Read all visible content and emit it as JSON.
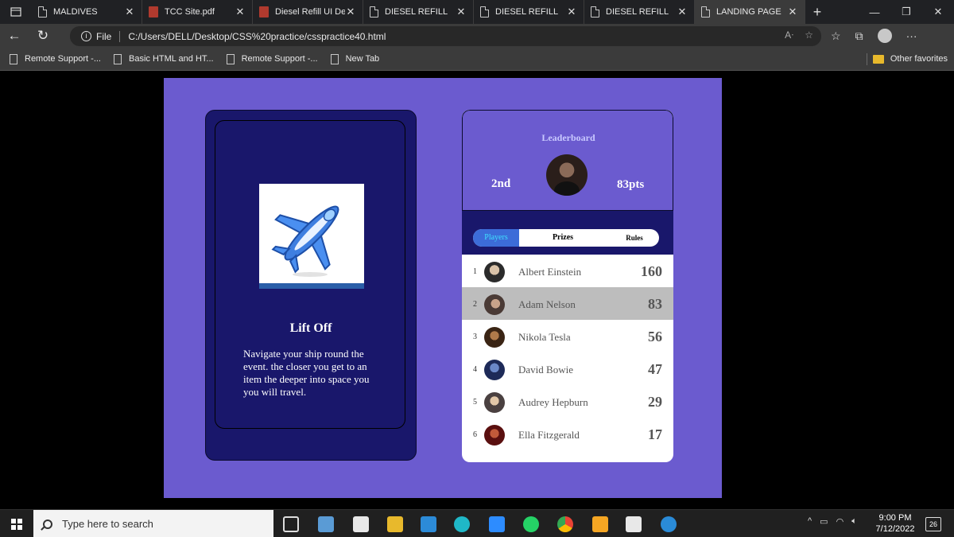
{
  "browser": {
    "tabs": [
      {
        "label": "MALDIVES",
        "icon": "document-icon"
      },
      {
        "label": "TCC Site.pdf",
        "icon": "pdf-icon"
      },
      {
        "label": "Diesel Refill UI De",
        "icon": "pdf-icon"
      },
      {
        "label": "DIESEL REFILL",
        "icon": "document-icon"
      },
      {
        "label": "DIESEL REFILL",
        "icon": "document-icon"
      },
      {
        "label": "DIESEL REFILL",
        "icon": "document-icon"
      },
      {
        "label": "LANDING PAGE",
        "icon": "document-icon",
        "active": true
      }
    ],
    "address": {
      "scheme_label": "File",
      "url": "C:/Users/DELL/Desktop/CSS%20practice/csspractice40.html"
    },
    "favorites": [
      {
        "label": "Remote Support -..."
      },
      {
        "label": "Basic HTML and HT..."
      },
      {
        "label": "Remote Support -..."
      },
      {
        "label": "New Tab"
      }
    ],
    "other_favorites": "Other favorites"
  },
  "card": {
    "title": "Lift Off",
    "description": "Navigate your ship round the event. the closer you get to an item the deeper into space you you will travel."
  },
  "leaderboard": {
    "title": "Leaderboard",
    "rank": "2nd",
    "points": "83pts",
    "tabs": {
      "players": "Players",
      "prizes": "Prizes",
      "rules": "Rules"
    },
    "players": [
      {
        "rank": "1",
        "name": "Albert Einstein",
        "score": "160"
      },
      {
        "rank": "2",
        "name": "Adam Nelson",
        "score": "83"
      },
      {
        "rank": "3",
        "name": "Nikola Tesla",
        "score": "56"
      },
      {
        "rank": "4",
        "name": "David Bowie",
        "score": "47"
      },
      {
        "rank": "5",
        "name": "Audrey Hepburn",
        "score": "29"
      },
      {
        "rank": "6",
        "name": "Ella Fitzgerald",
        "score": "17"
      }
    ]
  },
  "taskbar": {
    "search_placeholder": "Type here to search",
    "time": "9:00 PM",
    "date": "7/12/2022",
    "notifications": "26"
  },
  "colors": {
    "page_bg": "#6b5bcf",
    "card_bg": "#19176b",
    "tab_active": "#3c6cd8",
    "row_highlight": "#bdbdbd"
  }
}
